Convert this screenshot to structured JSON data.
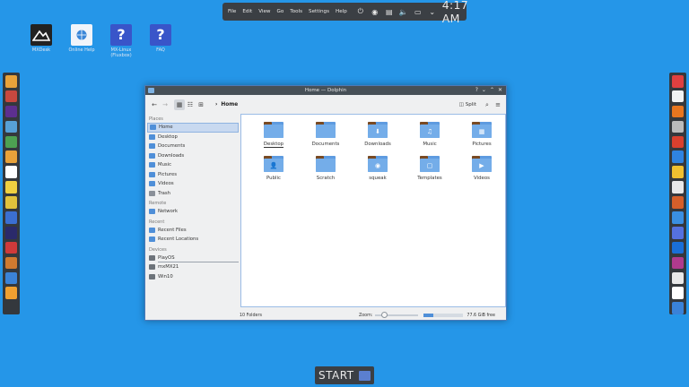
{
  "top_panel": {
    "menu": [
      "File",
      "Edit",
      "View",
      "Go",
      "Tools",
      "Settings",
      "Help"
    ],
    "clock": "4:17 AM"
  },
  "desktop_icons": [
    {
      "name": "desktop-icon-mxdesk",
      "label": "MXDesk"
    },
    {
      "name": "desktop-icon-online-help",
      "label": "Online Help"
    },
    {
      "name": "desktop-icon-wm-setup",
      "label": "MX-Linux (Fluxbox)"
    },
    {
      "name": "desktop-icon-faq",
      "label": "FAQ"
    }
  ],
  "window": {
    "title": "Home — Dolphin",
    "breadcrumb": "Home",
    "split_label": "Split",
    "sidebar": {
      "places_header": "Places",
      "places": [
        "Home",
        "Desktop",
        "Documents",
        "Downloads",
        "Music",
        "Pictures",
        "Videos",
        "Trash"
      ],
      "remote_header": "Remote",
      "remote": [
        "Network"
      ],
      "recent_header": "Recent",
      "recent": [
        "Recent Files",
        "Recent Locations"
      ],
      "devices_header": "Devices",
      "devices": [
        "PlayOS",
        "mxMX21",
        "Win10"
      ]
    },
    "files": [
      {
        "label": "Desktop",
        "glyph": ""
      },
      {
        "label": "Documents",
        "glyph": ""
      },
      {
        "label": "Downloads",
        "glyph": "⬇"
      },
      {
        "label": "Music",
        "glyph": "♫"
      },
      {
        "label": "Pictures",
        "glyph": "▦"
      },
      {
        "label": "Public",
        "glyph": "👤"
      },
      {
        "label": "Scratch",
        "glyph": ""
      },
      {
        "label": "squeak",
        "glyph": "◉"
      },
      {
        "label": "Templates",
        "glyph": "▢"
      },
      {
        "label": "Videos",
        "glyph": "▶"
      }
    ],
    "status": {
      "count": "10 Folders",
      "zoom_label": "Zoom:",
      "zoom_level": 0.2,
      "free": "77.6 GiB free",
      "used_fraction": 0.25
    }
  },
  "start": {
    "label": "START"
  },
  "colors": {
    "desktop": "#2596e8",
    "panel": "#3b3f44",
    "folder": "#5e9be0"
  },
  "dock_left": [
    "#e8a23a",
    "#c8483f",
    "#5d2f8f",
    "#57a0d6",
    "#4da152",
    "#e8a23a",
    "#ffffff",
    "#f0d040",
    "#e2c23c",
    "#3b6fd1",
    "#2a2a6a",
    "#d03a3a",
    "#d07a30",
    "#3b83d8",
    "#f0a030"
  ],
  "dock_right": [
    "#e04040",
    "#f2f2f2",
    "#e8761f",
    "#bbbbbb",
    "#d9402e",
    "#2f83e0",
    "#f0c030",
    "#e8e8e8",
    "#d55f2a",
    "#3a8fe2",
    "#5571e0",
    "#1a6fd8",
    "#b03a8e",
    "#e8e8e8",
    "#ffffff",
    "#3a82d8"
  ]
}
